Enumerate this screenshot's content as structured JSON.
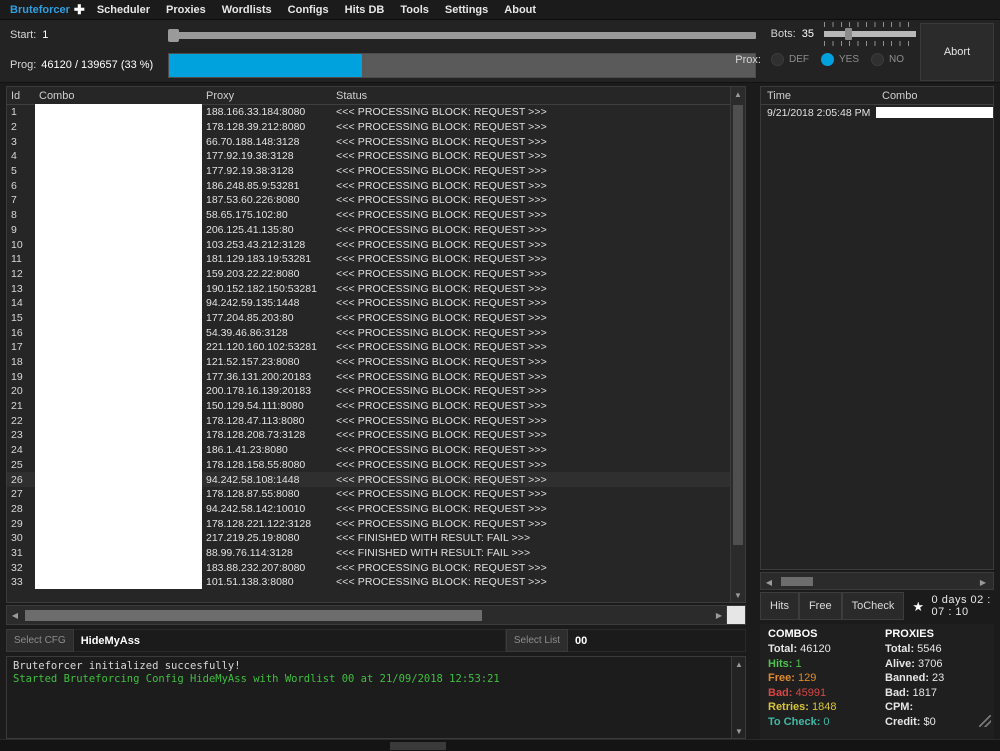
{
  "menu": {
    "brand": "Bruteforcer",
    "plus": "✚",
    "items": [
      "Scheduler",
      "Proxies",
      "Wordlists",
      "Configs",
      "Hits DB",
      "Tools",
      "Settings",
      "About"
    ]
  },
  "toolbar": {
    "start_label": "Start:",
    "start_value": "1",
    "prog_label": "Prog:",
    "prog_value": "46120 / 139657 (33 %)",
    "prog_percent": 33,
    "bots_label": "Bots:",
    "bots_value": "35",
    "prox_label": "Prox:",
    "prox_options": [
      "DEF",
      "YES",
      "NO"
    ],
    "prox_selected": "YES",
    "abort_label": "Abort"
  },
  "grid": {
    "columns": [
      "Id",
      "Combo",
      "Proxy",
      "Status"
    ],
    "selected_row_index": 25,
    "rows": [
      {
        "id": "1",
        "combo": "",
        "proxy": "188.166.33.184:8080",
        "status": "<<< PROCESSING BLOCK: REQUEST >>>"
      },
      {
        "id": "2",
        "combo": "",
        "proxy": "178.128.39.212:8080",
        "status": "<<< PROCESSING BLOCK: REQUEST >>>"
      },
      {
        "id": "3",
        "combo": "",
        "proxy": "66.70.188.148:3128",
        "status": "<<< PROCESSING BLOCK: REQUEST >>>"
      },
      {
        "id": "4",
        "combo": "",
        "proxy": "177.92.19.38:3128",
        "status": "<<< PROCESSING BLOCK: REQUEST >>>"
      },
      {
        "id": "5",
        "combo": "",
        "proxy": "177.92.19.38:3128",
        "status": "<<< PROCESSING BLOCK: REQUEST >>>"
      },
      {
        "id": "6",
        "combo": "",
        "proxy": "186.248.85.9:53281",
        "status": "<<< PROCESSING BLOCK: REQUEST >>>"
      },
      {
        "id": "7",
        "combo": "",
        "proxy": "187.53.60.226:8080",
        "status": "<<< PROCESSING BLOCK: REQUEST >>>"
      },
      {
        "id": "8",
        "combo": "",
        "proxy": "58.65.175.102:80",
        "status": "<<< PROCESSING BLOCK: REQUEST >>>"
      },
      {
        "id": "9",
        "combo": "",
        "proxy": "206.125.41.135:80",
        "status": "<<< PROCESSING BLOCK: REQUEST >>>"
      },
      {
        "id": "10",
        "combo": "",
        "proxy": "103.253.43.212:3128",
        "status": "<<< PROCESSING BLOCK: REQUEST >>>"
      },
      {
        "id": "11",
        "combo": "",
        "proxy": "181.129.183.19:53281",
        "status": "<<< PROCESSING BLOCK: REQUEST >>>"
      },
      {
        "id": "12",
        "combo": "",
        "proxy": "159.203.22.22:8080",
        "status": "<<< PROCESSING BLOCK: REQUEST >>>"
      },
      {
        "id": "13",
        "combo": "",
        "proxy": "190.152.182.150:53281",
        "status": "<<< PROCESSING BLOCK: REQUEST >>>"
      },
      {
        "id": "14",
        "combo": "",
        "proxy": "94.242.59.135:1448",
        "status": "<<< PROCESSING BLOCK: REQUEST >>>"
      },
      {
        "id": "15",
        "combo": "",
        "proxy": "177.204.85.203:80",
        "status": "<<< PROCESSING BLOCK: REQUEST >>>"
      },
      {
        "id": "16",
        "combo": "",
        "proxy": "54.39.46.86:3128",
        "status": "<<< PROCESSING BLOCK: REQUEST >>>"
      },
      {
        "id": "17",
        "combo": "",
        "proxy": "221.120.160.102:53281",
        "status": "<<< PROCESSING BLOCK: REQUEST >>>"
      },
      {
        "id": "18",
        "combo": "",
        "proxy": "121.52.157.23:8080",
        "status": "<<< PROCESSING BLOCK: REQUEST >>>"
      },
      {
        "id": "19",
        "combo": "",
        "proxy": "177.36.131.200:20183",
        "status": "<<< PROCESSING BLOCK: REQUEST >>>"
      },
      {
        "id": "20",
        "combo": "",
        "proxy": "200.178.16.139:20183",
        "status": "<<< PROCESSING BLOCK: REQUEST >>>"
      },
      {
        "id": "21",
        "combo": "",
        "proxy": "150.129.54.111:8080",
        "status": "<<< PROCESSING BLOCK: REQUEST >>>"
      },
      {
        "id": "22",
        "combo": "",
        "proxy": "178.128.47.113:8080",
        "status": "<<< PROCESSING BLOCK: REQUEST >>>"
      },
      {
        "id": "23",
        "combo": "",
        "proxy": "178.128.208.73:3128",
        "status": "<<< PROCESSING BLOCK: REQUEST >>>"
      },
      {
        "id": "24",
        "combo": "",
        "proxy": "186.1.41.23:8080",
        "status": "<<< PROCESSING BLOCK: REQUEST >>>"
      },
      {
        "id": "25",
        "combo": "",
        "proxy": "178.128.158.55:8080",
        "status": "<<< PROCESSING BLOCK: REQUEST >>>"
      },
      {
        "id": "26",
        "combo": "",
        "proxy": "94.242.58.108:1448",
        "status": "<<< PROCESSING BLOCK: REQUEST >>>"
      },
      {
        "id": "27",
        "combo": "",
        "proxy": "178.128.87.55:8080",
        "status": "<<< PROCESSING BLOCK: REQUEST >>>"
      },
      {
        "id": "28",
        "combo": "",
        "proxy": "94.242.58.142:10010",
        "status": "<<< PROCESSING BLOCK: REQUEST >>>"
      },
      {
        "id": "29",
        "combo": "",
        "proxy": "178.128.221.122:3128",
        "status": "<<< PROCESSING BLOCK: REQUEST >>>"
      },
      {
        "id": "30",
        "combo": "",
        "proxy": "217.219.25.19:8080",
        "status": "<<< FINISHED WITH RESULT: FAIL >>>"
      },
      {
        "id": "31",
        "combo": "",
        "proxy": "88.99.76.114:3128",
        "status": "<<< FINISHED WITH RESULT: FAIL >>>"
      },
      {
        "id": "32",
        "combo": "",
        "proxy": "183.88.232.207:8080",
        "status": "<<< PROCESSING BLOCK: REQUEST >>>"
      },
      {
        "id": "33",
        "combo": "",
        "proxy": "101.51.138.3:8080",
        "status": "<<< PROCESSING BLOCK: REQUEST >>>"
      }
    ]
  },
  "selectors": {
    "cfg_button": "Select CFG",
    "cfg_value": "HideMyAss",
    "list_button": "Select List",
    "list_value": "00"
  },
  "log": {
    "lines": [
      "Bruteforcer initialized succesfully!",
      "Started Bruteforcing Config HideMyAss with Wordlist 00 at 21/09/2018 12:53:21"
    ]
  },
  "hits": {
    "columns": [
      "Time",
      "Combo"
    ],
    "rows": [
      {
        "time": "9/21/2018 2:05:48 PM",
        "combo": ""
      }
    ]
  },
  "tabs": {
    "items": [
      "Hits",
      "Free",
      "ToCheck"
    ],
    "active": "Hits"
  },
  "timer": {
    "star": "★",
    "text": "0 days 02 : 07 : 10"
  },
  "stats": {
    "combos": {
      "title": "COMBOS",
      "lines": [
        {
          "key": "Total:",
          "value": "46120",
          "tone": "st-total"
        },
        {
          "key": "Hits:",
          "value": "1",
          "tone": "st-hits"
        },
        {
          "key": "Free:",
          "value": "129",
          "tone": "st-free"
        },
        {
          "key": "Bad:",
          "value": "45991",
          "tone": "st-bad"
        },
        {
          "key": "Retries:",
          "value": "1848",
          "tone": "st-retries"
        },
        {
          "key": "To Check:",
          "value": "0",
          "tone": "st-tocheck"
        }
      ]
    },
    "proxies": {
      "title": "PROXIES",
      "lines": [
        {
          "key": "Total:",
          "value": "5546",
          "tone": "st-plain"
        },
        {
          "key": "Alive:",
          "value": "3706",
          "tone": "st-plain"
        },
        {
          "key": "Banned:",
          "value": "23",
          "tone": "st-plain"
        },
        {
          "key": "Bad:",
          "value": "1817",
          "tone": "st-plain"
        },
        {
          "key": "CPM:",
          "value": "",
          "tone": "st-plain"
        },
        {
          "key": "Credit:",
          "value": "$0",
          "tone": "st-plain"
        }
      ]
    }
  },
  "colors": {
    "accent": "#2e9fe0",
    "progress": "#00a2dd",
    "background": "#1b1b1b",
    "panel": "#232323"
  }
}
